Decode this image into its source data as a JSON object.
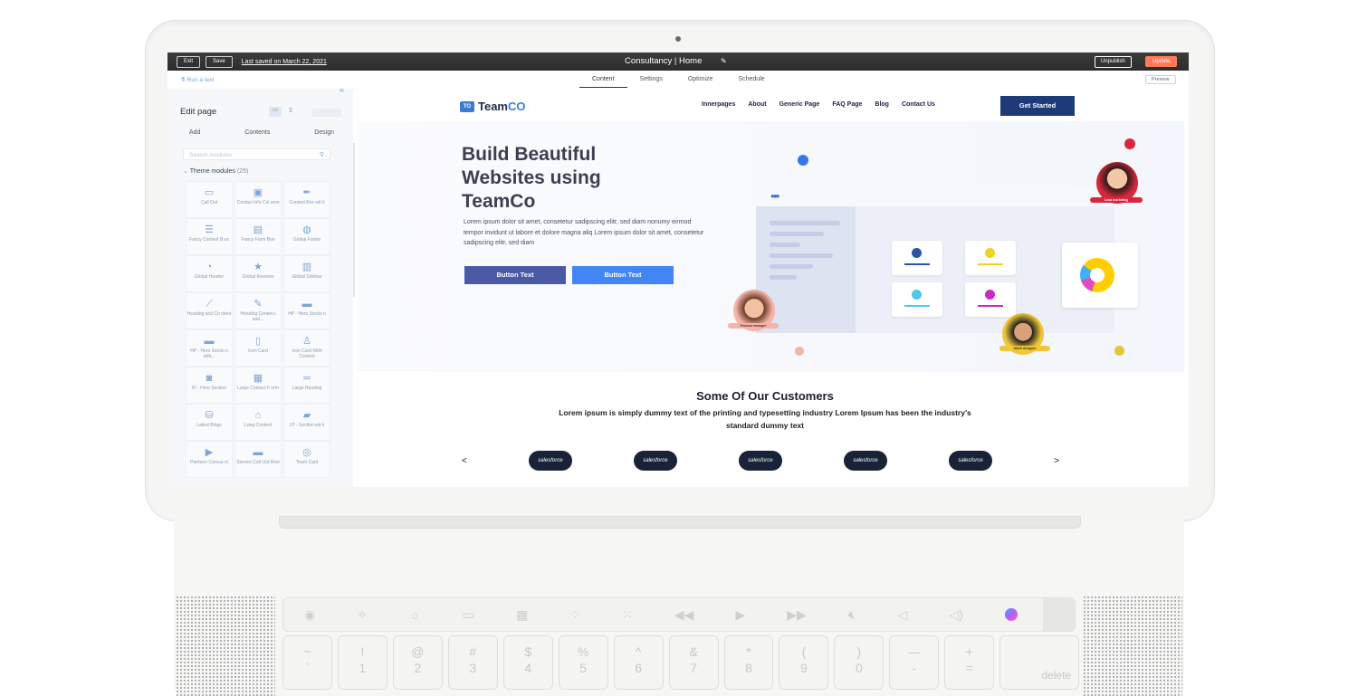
{
  "topbar": {
    "exit_label": "Exit",
    "save_label": "Save",
    "last_saved": "Last saved on March 22, 2021",
    "page_title": "Consultancy | Home",
    "unpublish_label": "Unpublish",
    "update_label": "Update"
  },
  "subbar": {
    "run_text": "Run a text",
    "tabs": [
      "Content",
      "Settings",
      "Optimize",
      "Schedule"
    ],
    "active_tab": "Content",
    "preview_label": "Preview"
  },
  "panel": {
    "title": "Edit page",
    "tabs": [
      "Add",
      "Contents",
      "Design"
    ],
    "search_placeholder": "Search modules",
    "section_title": "Theme modules",
    "section_count": "(25)",
    "modules": [
      {
        "label": "Call Out",
        "icon": "chat-icon"
      },
      {
        "label": "Contact Info Col umn",
        "icon": "contact-icon"
      },
      {
        "label": "Content Box wit h",
        "icon": "feather-icon"
      },
      {
        "label": "Fancy Content B ox",
        "icon": "list-icon"
      },
      {
        "label": "Fancy Form Box",
        "icon": "form-icon"
      },
      {
        "label": "Global Footer",
        "icon": "globe-icon"
      },
      {
        "label": "Global Header",
        "icon": "gauge-icon"
      },
      {
        "label": "Global Reviews",
        "icon": "star-icon"
      },
      {
        "label": "Global Sidebar",
        "icon": "sidebar-icon"
      },
      {
        "label": "Heading and Co ntent",
        "icon": "brush-icon"
      },
      {
        "label": "Heading Conten t and...",
        "icon": "edit-icon"
      },
      {
        "label": "HP - Hero Sectio n",
        "icon": "hero-icon"
      },
      {
        "label": "HP - Hero Sectio n with...",
        "icon": "hero-icon"
      },
      {
        "label": "Icon Card",
        "icon": "book-icon"
      },
      {
        "label": "Icon Card With Content",
        "icon": "reader-icon"
      },
      {
        "label": "IP - Hero Section",
        "icon": "camera-icon"
      },
      {
        "label": "Large Contact F orm",
        "icon": "cc-icon"
      },
      {
        "label": "Large Heading",
        "icon": "heading-icon"
      },
      {
        "label": "Latest Blogs",
        "icon": "database-icon"
      },
      {
        "label": "Long Content",
        "icon": "paint-icon"
      },
      {
        "label": "LP - Section wit h",
        "icon": "roller-icon"
      },
      {
        "label": "Partners Carous el",
        "icon": "play-icon"
      },
      {
        "label": "Service Call Out Row",
        "icon": "minus-icon"
      },
      {
        "label": "Team Card",
        "icon": "team-icon"
      }
    ]
  },
  "site": {
    "logo_badge": "TO",
    "logo_part1": "Team",
    "logo_part2": "CO",
    "nav": [
      "Innerpages",
      "About",
      "Generic Page",
      "FAQ Page",
      "Blog",
      "Contact Us"
    ],
    "cta": "Get Started",
    "hero_title": "Build Beautiful Websites using TeamCo",
    "hero_text": "Lorem ipsum dolor sit amet, consetetur sadipscing elitr, sed diam nonumy eirmod tempor invidunt ut labore et dolore magna aliq Lorem ipsum dolor sit amet, consetetur sadipscing elitr, sed diam",
    "button1": "Button Text",
    "button2": "Button Text",
    "tag_lead": "Lead marketing",
    "tag_product": "Product manager",
    "tag_ui": "UI/UX designer",
    "customers_title": "Some Of Our Customers",
    "customers_sub": "Lorem ipsum is simply dummy text of the printing and typesetting industry Lorem Ipsum has been the industry's standard dummy text",
    "logos": [
      "salesforce",
      "salesforce",
      "salesforce",
      "salesforce",
      "salesforce"
    ],
    "prev": "<",
    "next": ">"
  },
  "keyboard": {
    "keys": [
      {
        "top": "~",
        "bottom": "`"
      },
      {
        "top": "!",
        "bottom": "1"
      },
      {
        "top": "@",
        "bottom": "2"
      },
      {
        "top": "#",
        "bottom": "3"
      },
      {
        "top": "$",
        "bottom": "4"
      },
      {
        "top": "%",
        "bottom": "5"
      },
      {
        "top": "^",
        "bottom": "6"
      },
      {
        "top": "&",
        "bottom": "7"
      },
      {
        "top": "*",
        "bottom": "8"
      },
      {
        "top": "(",
        "bottom": "9"
      },
      {
        "top": ")",
        "bottom": "0"
      },
      {
        "top": "—",
        "bottom": "-"
      },
      {
        "top": "+",
        "bottom": "="
      }
    ],
    "delete_label": "delete"
  },
  "colors": {
    "accent_blue": "#4285f4",
    "navy": "#1e3a78",
    "update_orange": "#ff7a59"
  }
}
